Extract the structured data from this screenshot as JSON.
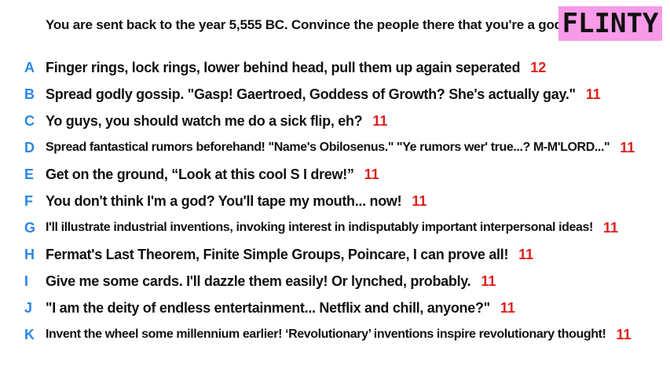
{
  "prompt": "You are sent back to the year 5,555 BC. Convince the people there that you're a god.",
  "badge": {
    "label": "FLINTY",
    "color": "#f79ae8"
  },
  "colors": {
    "letter": "#2b86e8",
    "score": "#e0201d",
    "text": "#111111"
  },
  "answers": [
    {
      "letter": "A",
      "text": "Finger rings, lock rings, lower behind head, pull them up again seperated",
      "score": "12"
    },
    {
      "letter": "B",
      "text": "Spread godly gossip. \"Gasp! Gaertroed, Goddess of Growth? She's actually gay.\"",
      "score": "11"
    },
    {
      "letter": "C",
      "text": "Yo guys, you should watch me do a sick flip, eh?",
      "score": "11"
    },
    {
      "letter": "D",
      "text": "Spread fantastical rumors beforehand! \"Name's Obilosenus.\" \"Ye rumors wer' true...? M-M'LORD...\"",
      "score": "11"
    },
    {
      "letter": "E",
      "text": "Get on the ground, “Look at this cool S I drew!”",
      "score": "11"
    },
    {
      "letter": "F",
      "text": "You don't think I'm a god? You'll tape my mouth... now!",
      "score": "11"
    },
    {
      "letter": "G",
      "text": "I'll illustrate industrial inventions, invoking interest in indisputably important interpersonal ideas!",
      "score": "11"
    },
    {
      "letter": "H",
      "text": "Fermat's Last Theorem, Finite Simple Groups, Poincare, I can prove all!",
      "score": "11"
    },
    {
      "letter": "I",
      "text": "Give me some cards. I'll dazzle them easily! Or lynched, probably.",
      "score": "11"
    },
    {
      "letter": "J",
      "text": "\"I am the deity of endless entertainment... Netflix and chill, anyone?\"",
      "score": "11"
    },
    {
      "letter": "K",
      "text": "Invent the wheel some millennium earlier! ‘Revolutionary’ inventions inspire revolutionary thought!",
      "score": "11"
    }
  ]
}
